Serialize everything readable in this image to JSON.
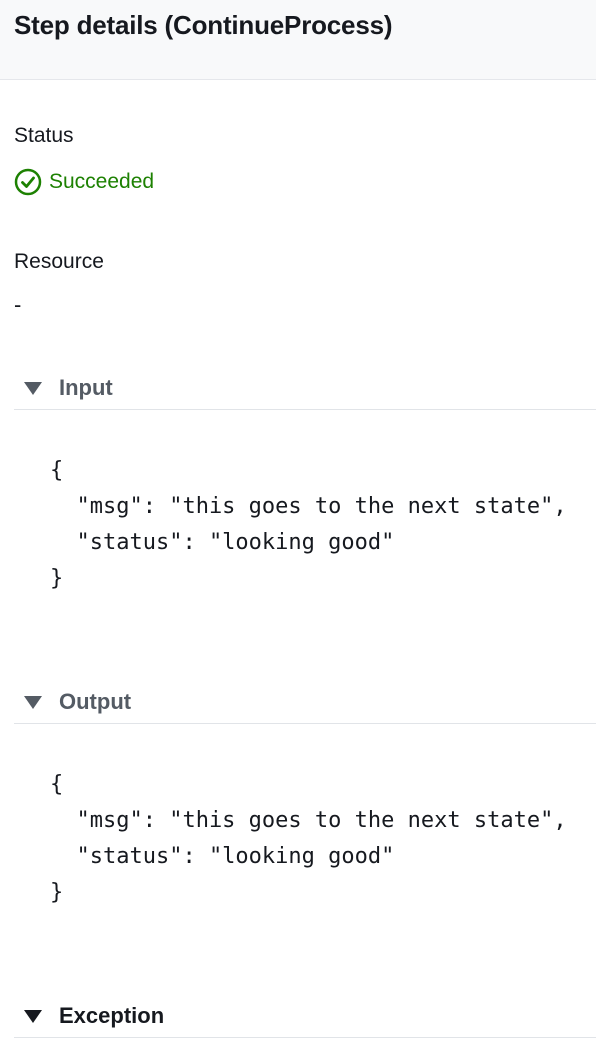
{
  "header": {
    "title": "Step details (ContinueProcess)"
  },
  "status": {
    "label": "Status",
    "value": "Succeeded",
    "icon": "check-circle-icon",
    "color": "#1d8102"
  },
  "resource": {
    "label": "Resource",
    "value": "-"
  },
  "sections": {
    "input": {
      "title": "Input",
      "json_lines": [
        "{",
        "  \"msg\": \"this goes to the next state\",",
        "  \"status\": \"looking good\"",
        "}"
      ]
    },
    "output": {
      "title": "Output",
      "json_lines": [
        "{",
        "  \"msg\": \"this goes to the next state\",",
        "  \"status\": \"looking good\"",
        "}"
      ]
    },
    "exception": {
      "title": "Exception"
    }
  }
}
